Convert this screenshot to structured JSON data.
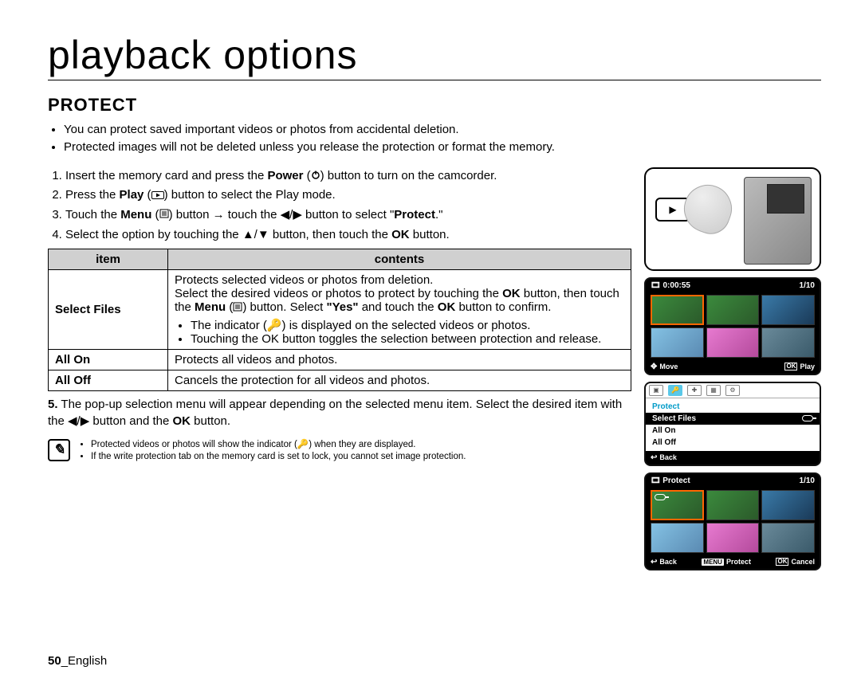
{
  "page": {
    "chapter_title": "playback options",
    "section_title": "PROTECT",
    "intro_bullets": [
      "You can protect saved important videos or photos from accidental deletion.",
      "Protected images will not be deleted unless you release the protection or format the memory."
    ],
    "steps": {
      "s1_a": "Insert the memory card and press the ",
      "s1_power": "Power",
      "s1_b": " button to turn on the camcorder.",
      "s2_a": "Press the ",
      "s2_play": "Play",
      "s2_b": " button to select the Play mode.",
      "s3_a": "Touch the ",
      "s3_menu": "Menu",
      "s3_b": " button → touch the ◀/▶ button to select \"",
      "s3_protect": "Protect",
      "s3_c": ".\"",
      "s4_a": "Select the option by touching the ▲/▼ button, then touch the ",
      "s4_ok": "OK",
      "s4_b": " button."
    },
    "table": {
      "header_item": "item",
      "header_contents": "contents",
      "rows": [
        {
          "item": "Select Files",
          "intro_a": "Protects selected videos or photos from deletion.",
          "intro_b1": "Select the desired videos or photos to protect by touching the ",
          "intro_ok": "OK",
          "intro_b2": " button, then touch the ",
          "intro_menu": "Menu",
          "intro_b3": " button. Select ",
          "intro_yes": "\"Yes\"",
          "intro_b4": " and touch the ",
          "intro_ok2": "OK",
          "intro_b5": " button to confirm.",
          "sub_bullets": [
            "The indicator (🔑) is displayed on the selected videos or photos.",
            "Touching the OK button toggles the selection between protection and release."
          ]
        },
        {
          "item": "All On",
          "contents": "Protects all videos and photos."
        },
        {
          "item": "All Off",
          "contents": "Cancels the protection for all videos and photos."
        }
      ]
    },
    "step5_num": "5.",
    "step5_a": "The pop-up selection menu will appear depending on the selected menu item. Select the desired item with the ◀/▶ button and the ",
    "step5_ok": "OK",
    "step5_b": " button.",
    "notes": [
      "Protected videos or photos will show the indicator (🔑) when they are displayed.",
      "If the write protection tab on the memory card is set to lock, you cannot set image protection."
    ],
    "footer_page": "50",
    "footer_lang": "_English"
  },
  "screens": {
    "thumbs1": {
      "time": "0:00:55",
      "counter": "1/10",
      "bot_move": "Move",
      "bot_play": "Play"
    },
    "menu": {
      "title": "Protect",
      "items": [
        "Select Files",
        "All On",
        "All Off"
      ],
      "back": "Back"
    },
    "thumbs2": {
      "title": "Protect",
      "counter": "1/10",
      "bot_back": "Back",
      "bot_protect": "Protect",
      "bot_cancel": "Cancel"
    }
  }
}
